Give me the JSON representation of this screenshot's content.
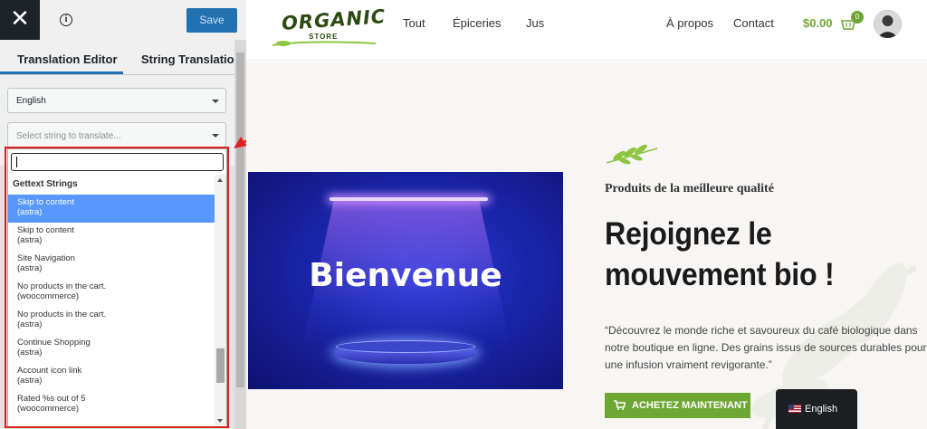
{
  "panel": {
    "close_glyph": "✕",
    "info_glyph": "i",
    "save_label": "Save",
    "tabs": [
      {
        "label": "Translation Editor",
        "active": true
      },
      {
        "label": "String Translation",
        "active": false
      }
    ],
    "language": "English",
    "string_placeholder": "Select string to translate...",
    "dropdown": {
      "search_value": "",
      "group": "Gettext Strings",
      "options": [
        {
          "line1": "Skip to content",
          "line2": "(astra)",
          "active": true
        },
        {
          "line1": "Skip to content",
          "line2": "(astra)",
          "active": false
        },
        {
          "line1": "Site Navigation",
          "line2": "(astra)",
          "active": false
        },
        {
          "line1": "No products in the cart.",
          "line2": "(woocommerce)",
          "active": false
        },
        {
          "line1": "No products in the cart.",
          "line2": "(astra)",
          "active": false
        },
        {
          "line1": "Continue Shopping",
          "line2": "(astra)",
          "active": false
        },
        {
          "line1": "Account icon link",
          "line2": "(astra)",
          "active": false
        },
        {
          "line1": "Rated %s out of 5",
          "line2": "(woocommerce)",
          "active": false
        }
      ]
    }
  },
  "site": {
    "logo_text": "ORGANIC",
    "logo_sub": "STORE",
    "nav": [
      "Tout",
      "Épiceries",
      "Jus",
      "À propos",
      "Contact"
    ],
    "cart_total": "$0.00",
    "cart_count": "0",
    "banner_text": "Bienvenue",
    "eyebrow": "Produits de la meilleure qualité",
    "headline_line1": "Rejoignez le",
    "headline_line2": "mouvement bio !",
    "description": "“Découvrez le monde riche et savoureux du café biologique dans notre boutique en ligne. Des grains issus de sources durables pour une infusion vraiment revigorante.”",
    "cta_label": "ACHETEZ MAINTENANT",
    "language_switcher": "English"
  },
  "colors": {
    "accent_green": "#6ea634",
    "save_blue": "#2271b1",
    "highlight_red": "#e02020",
    "selected_option": "#5897fb"
  }
}
